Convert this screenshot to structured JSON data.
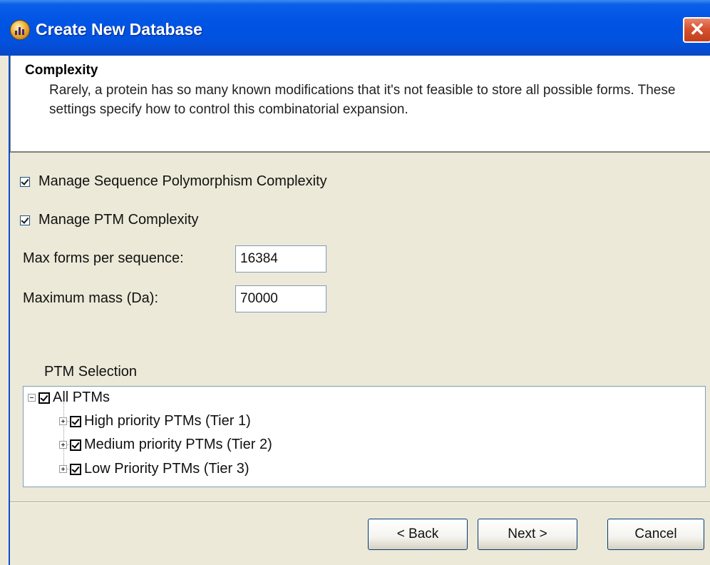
{
  "window": {
    "title": "Create New Database",
    "close_label": "✕"
  },
  "header": {
    "title": "Complexity",
    "description": "Rarely, a protein has so many known modifications that it's not feasible to store all possible forms.  These settings specify how to control this combinatorial expansion."
  },
  "options": {
    "polymorphism_label": "Manage Sequence Polymorphism Complexity",
    "polymorphism_checked": true,
    "ptm_label": "Manage PTM Complexity",
    "ptm_checked": true
  },
  "fields": {
    "max_forms_label": "Max forms per sequence:",
    "max_forms_value": "16384",
    "max_mass_label": "Maximum mass (Da):",
    "max_mass_value": "70000"
  },
  "ptm_selection": {
    "label": "PTM Selection",
    "root": "All PTMs",
    "items": [
      "High priority PTMs (Tier 1)",
      "Medium priority PTMs (Tier 2)",
      "Low Priority PTMs (Tier 3)"
    ]
  },
  "buttons": {
    "back": "< Back",
    "next": "Next >",
    "cancel": "Cancel"
  }
}
